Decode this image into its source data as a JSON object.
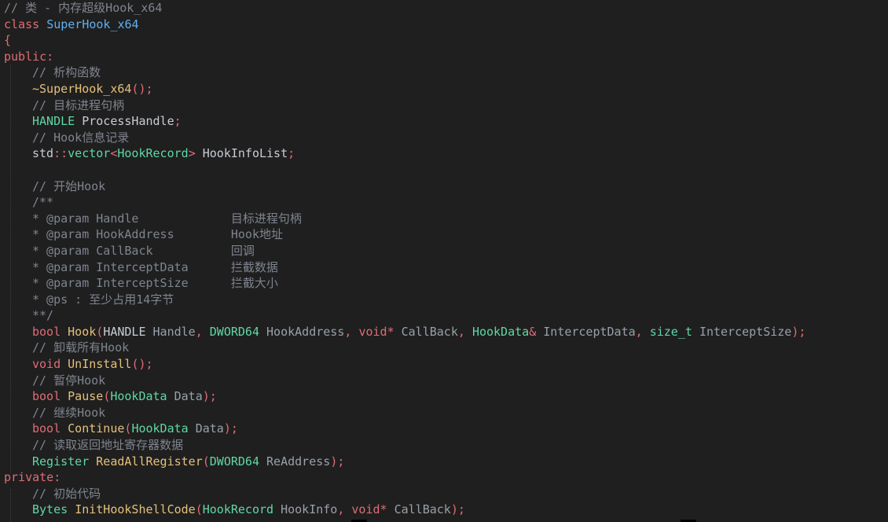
{
  "lines": [
    {
      "tokens": [
        {
          "t": "// 类 - 内存超级Hook_x64",
          "c": "cm"
        }
      ]
    },
    {
      "tokens": [
        {
          "t": "class ",
          "c": "kw"
        },
        {
          "t": "SuperHook_x64",
          "c": "cls"
        }
      ]
    },
    {
      "tokens": [
        {
          "t": "{",
          "c": "punc"
        }
      ]
    },
    {
      "tokens": [
        {
          "t": "public:",
          "c": "kw"
        }
      ]
    },
    {
      "indent": 1,
      "tokens": [
        {
          "t": "// 析构函数",
          "c": "cm"
        }
      ]
    },
    {
      "indent": 1,
      "tokens": [
        {
          "t": "~SuperHook_x64",
          "c": "fn"
        },
        {
          "t": "();",
          "c": "punc"
        }
      ]
    },
    {
      "indent": 1,
      "tokens": [
        {
          "t": "// 目标进程句柄",
          "c": "cm"
        }
      ]
    },
    {
      "indent": 1,
      "tokens": [
        {
          "t": "HANDLE ",
          "c": "type"
        },
        {
          "t": "ProcessHandle",
          "c": "id"
        },
        {
          "t": ";",
          "c": "punc"
        }
      ]
    },
    {
      "indent": 1,
      "tokens": [
        {
          "t": "// Hook信息记录",
          "c": "cm"
        }
      ]
    },
    {
      "indent": 1,
      "tokens": [
        {
          "t": "std",
          "c": "id"
        },
        {
          "t": "::",
          "c": "punc"
        },
        {
          "t": "vector",
          "c": "type"
        },
        {
          "t": "<",
          "c": "punc"
        },
        {
          "t": "HookRecord",
          "c": "type"
        },
        {
          "t": "> ",
          "c": "punc"
        },
        {
          "t": "HookInfoList",
          "c": "id"
        },
        {
          "t": ";",
          "c": "punc"
        }
      ]
    },
    {
      "indent": 0,
      "tokens": []
    },
    {
      "indent": 1,
      "tokens": [
        {
          "t": "// 开始Hook",
          "c": "cm"
        }
      ]
    },
    {
      "indent": 1,
      "tokens": [
        {
          "t": "/**",
          "c": "cm"
        }
      ]
    },
    {
      "indent": 1,
      "tokens": [
        {
          "t": "* @param Handle             目标进程句柄",
          "c": "cm"
        }
      ]
    },
    {
      "indent": 1,
      "tokens": [
        {
          "t": "* @param HookAddress        Hook地址",
          "c": "cm"
        }
      ]
    },
    {
      "indent": 1,
      "tokens": [
        {
          "t": "* @param CallBack           回调",
          "c": "cm"
        }
      ]
    },
    {
      "indent": 1,
      "tokens": [
        {
          "t": "* @param InterceptData      拦截数据",
          "c": "cm"
        }
      ]
    },
    {
      "indent": 1,
      "tokens": [
        {
          "t": "* @param InterceptSize      拦截大小",
          "c": "cm"
        }
      ]
    },
    {
      "indent": 1,
      "tokens": [
        {
          "t": "* @ps : 至少占用14字节",
          "c": "cm"
        }
      ]
    },
    {
      "indent": 1,
      "tokens": [
        {
          "t": "**/",
          "c": "cm"
        }
      ]
    },
    {
      "indent": 1,
      "tokens": [
        {
          "t": "bool ",
          "c": "kw"
        },
        {
          "t": "Hook",
          "c": "fn"
        },
        {
          "t": "(",
          "c": "punc"
        },
        {
          "t": "HANDLE ",
          "c": "id"
        },
        {
          "t": "Handle",
          "c": "dim"
        },
        {
          "t": ", ",
          "c": "punc"
        },
        {
          "t": "DWORD64 ",
          "c": "type"
        },
        {
          "t": "HookAddress",
          "c": "dim"
        },
        {
          "t": ", ",
          "c": "punc"
        },
        {
          "t": "void",
          "c": "kw"
        },
        {
          "t": "* ",
          "c": "punc"
        },
        {
          "t": "CallBack",
          "c": "dim"
        },
        {
          "t": ", ",
          "c": "punc"
        },
        {
          "t": "HookData",
          "c": "type"
        },
        {
          "t": "& ",
          "c": "punc"
        },
        {
          "t": "InterceptData",
          "c": "dim"
        },
        {
          "t": ", ",
          "c": "punc"
        },
        {
          "t": "size_t ",
          "c": "type"
        },
        {
          "t": "InterceptSize",
          "c": "dim"
        },
        {
          "t": ");",
          "c": "punc"
        }
      ]
    },
    {
      "indent": 1,
      "tokens": [
        {
          "t": "// 卸载所有Hook",
          "c": "cm"
        }
      ]
    },
    {
      "indent": 1,
      "tokens": [
        {
          "t": "void ",
          "c": "kw"
        },
        {
          "t": "UnInstall",
          "c": "fn"
        },
        {
          "t": "();",
          "c": "punc"
        }
      ]
    },
    {
      "indent": 1,
      "tokens": [
        {
          "t": "// 暂停Hook",
          "c": "cm"
        }
      ]
    },
    {
      "indent": 1,
      "tokens": [
        {
          "t": "bool ",
          "c": "kw"
        },
        {
          "t": "Pause",
          "c": "fn"
        },
        {
          "t": "(",
          "c": "punc"
        },
        {
          "t": "HookData ",
          "c": "type"
        },
        {
          "t": "Data",
          "c": "dim"
        },
        {
          "t": ");",
          "c": "punc"
        }
      ]
    },
    {
      "indent": 1,
      "tokens": [
        {
          "t": "// 继续Hook",
          "c": "cm"
        }
      ]
    },
    {
      "indent": 1,
      "tokens": [
        {
          "t": "bool ",
          "c": "kw"
        },
        {
          "t": "Continue",
          "c": "fn"
        },
        {
          "t": "(",
          "c": "punc"
        },
        {
          "t": "HookData ",
          "c": "type"
        },
        {
          "t": "Data",
          "c": "dim"
        },
        {
          "t": ");",
          "c": "punc"
        }
      ]
    },
    {
      "indent": 1,
      "tokens": [
        {
          "t": "// 读取返回地址寄存器数据",
          "c": "cm"
        }
      ]
    },
    {
      "indent": 1,
      "tokens": [
        {
          "t": "Register ",
          "c": "type"
        },
        {
          "t": "ReadAllRegister",
          "c": "fn"
        },
        {
          "t": "(",
          "c": "punc"
        },
        {
          "t": "DWORD64 ",
          "c": "type"
        },
        {
          "t": "ReAddress",
          "c": "dim"
        },
        {
          "t": ");",
          "c": "punc"
        }
      ]
    },
    {
      "tokens": [
        {
          "t": "private:",
          "c": "kw"
        }
      ]
    },
    {
      "indent": 1,
      "tokens": [
        {
          "t": "// 初始代码",
          "c": "cm"
        }
      ]
    },
    {
      "indent": 1,
      "tokens": [
        {
          "t": "Bytes ",
          "c": "type"
        },
        {
          "t": "InitHookShellCode",
          "c": "fn"
        },
        {
          "t": "(",
          "c": "punc"
        },
        {
          "t": "HookRecord ",
          "c": "type"
        },
        {
          "t": "HookInfo",
          "c": "dim"
        },
        {
          "t": ", ",
          "c": "punc"
        },
        {
          "t": "void",
          "c": "kw"
        },
        {
          "t": "* ",
          "c": "punc"
        },
        {
          "t": "CallBack",
          "c": "dim"
        },
        {
          "t": ");",
          "c": "punc"
        }
      ]
    }
  ]
}
